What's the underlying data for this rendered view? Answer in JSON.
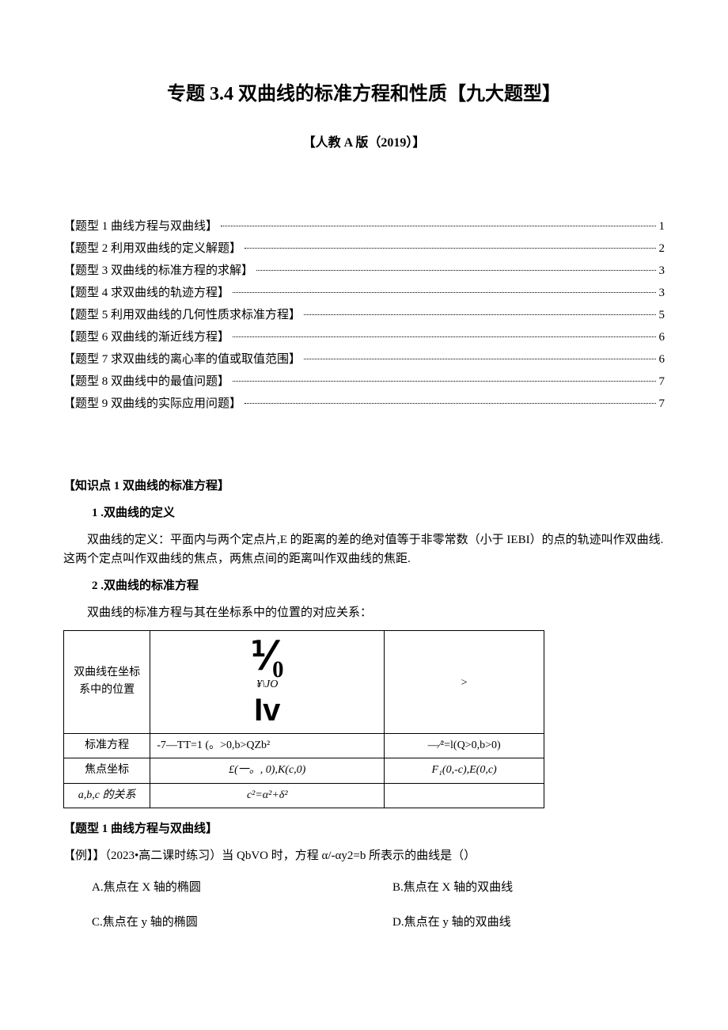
{
  "title": "专题 3.4 双曲线的标准方程和性质【九大题型】",
  "subtitle": "【人教 A 版（2019）】",
  "toc": [
    {
      "label": "【题型 1 曲线方程与双曲线】",
      "page": "1"
    },
    {
      "label": "【题型 2 利用双曲线的定义解题】",
      "page": "2"
    },
    {
      "label": "【题型 3 双曲线的标准方程的求解】",
      "page": "3"
    },
    {
      "label": "【题型 4 求双曲线的轨迹方程】",
      "page": "3"
    },
    {
      "label": "【题型 5 利用双曲线的几何性质求标准方程】",
      "page": "5"
    },
    {
      "label": "【题型 6 双曲线的渐近线方程】",
      "page": "6"
    },
    {
      "label": "【题型 7 求双曲线的离心率的值或取值范围】",
      "page": "6"
    },
    {
      "label": "【题型 8 双曲线中的最值问题】",
      "page": "7"
    },
    {
      "label": "【题型 9 双曲线的实际应用问题】",
      "page": "7"
    }
  ],
  "knowledge": {
    "heading": "【知识点 1 双曲线的标准方程】",
    "sub1_title": "1 .双曲线的定义",
    "sub1_body": "双曲线的定义：平面内与两个定点片,E 的距离的差的绝对值等于非零常数（小于 IEBI）的点的轨迹叫作双曲线. 这两个定点叫作双曲线的焦点，两焦点间的距离叫作双曲线的焦距.",
    "sub2_title": "2 .双曲线的标准方程",
    "sub2_body": "双曲线的标准方程与其在坐标系中的位置的对应关系：",
    "table": {
      "row1_label": "双曲线在坐标系中的位置",
      "row1_cell1_top": "¥\\JO",
      "row1_cell2_top": ">",
      "row2_label": "标准方程",
      "row2_cell1": "-7—TT=1 (。>0,b>QZb²",
      "row2_cell2": "—∕²=l(Q>0,b>0)",
      "row3_label": "焦点坐标",
      "row3_cell1": "£(一。, 0),K(c,0)",
      "row3_cell2": "F₁(0,-c),E(0,c)",
      "row4_label": "a,b,c 的关系",
      "row4_cell1": "c²=α²+δ²",
      "row4_cell2": ""
    }
  },
  "q1": {
    "heading": "【题型 1 曲线方程与双曲线】",
    "stem": "【例】】（2023•高二课时练习）当 QbVO 时，方程 α/-αy2=b 所表示的曲线是（）",
    "optA": "A.焦点在 X 轴的椭圆",
    "optB": "B.焦点在 X 轴的双曲线",
    "optC": "C.焦点在 y 轴的椭圆",
    "optD": "D.焦点在 y 轴的双曲线"
  }
}
